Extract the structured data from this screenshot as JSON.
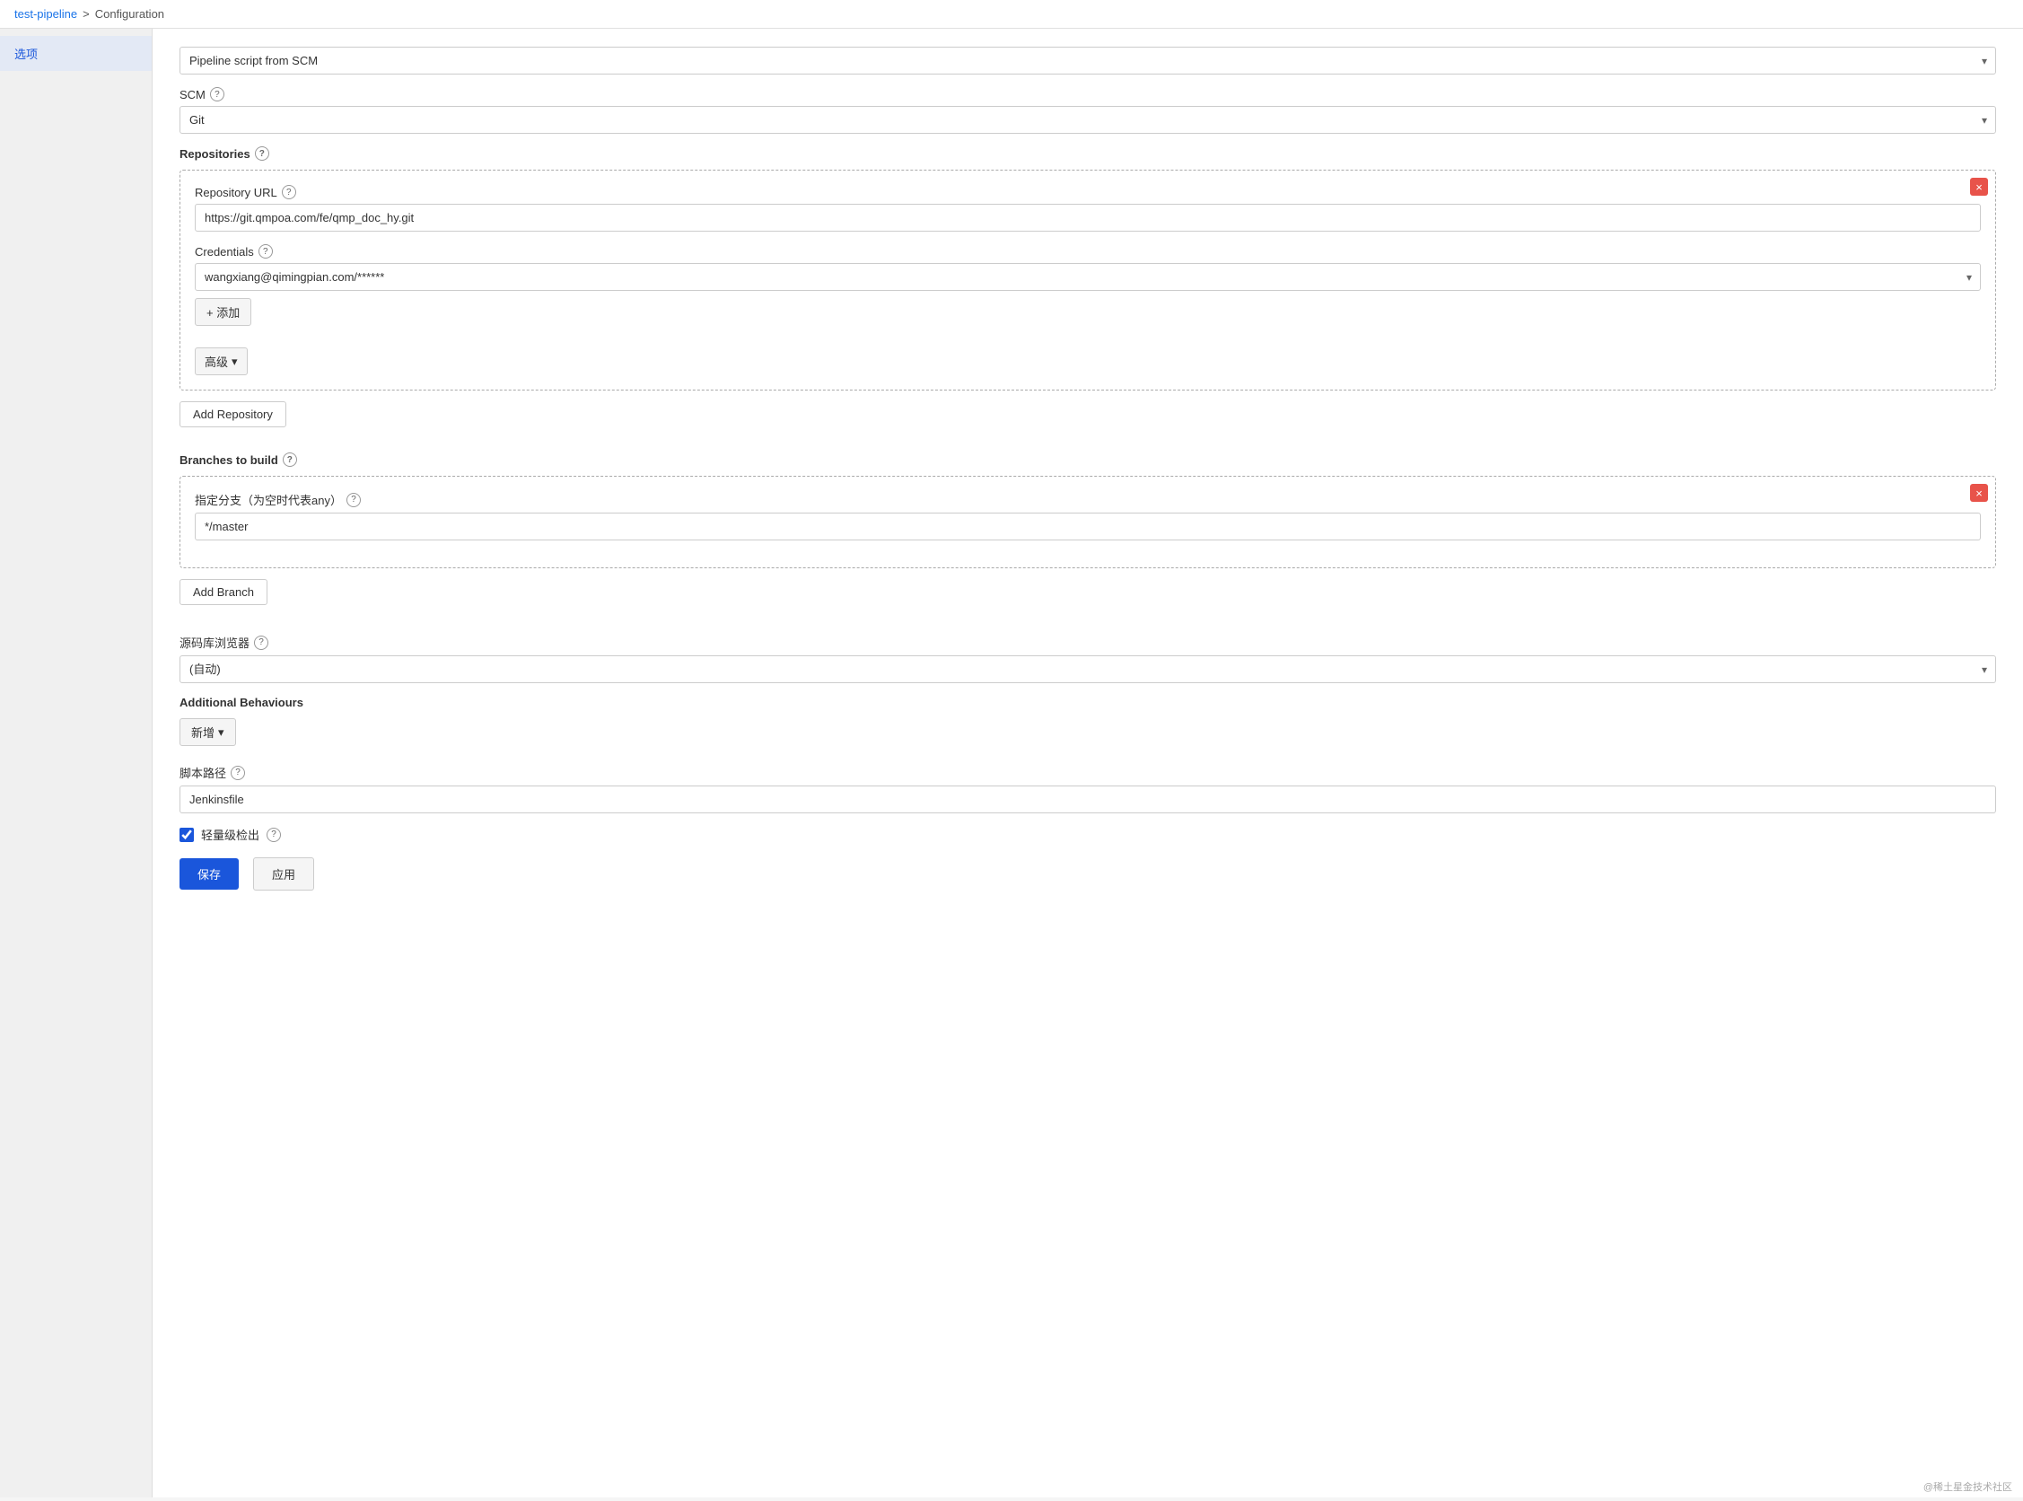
{
  "breadcrumb": {
    "project": "test-pipeline",
    "separator": ">",
    "page": "Configuration"
  },
  "sidebar": {
    "items": [
      {
        "label": "选项",
        "active": true
      }
    ]
  },
  "pipeline": {
    "script_source_label": "Pipeline script from SCM",
    "scm_label": "SCM",
    "scm_value": "Git",
    "repositories_label": "Repositories",
    "repository_url_label": "Repository URL",
    "repository_url_value": "https://git.qmpoa.com/fe/qmp_doc_hy.git",
    "credentials_label": "Credentials",
    "credentials_value": "wangxiang@qimingpian.com/******",
    "add_credential_btn": "+ 添加",
    "advanced_btn": "高级",
    "add_repository_btn": "Add Repository",
    "branches_label": "Branches to build",
    "branch_specifier_label": "指定分支（为空时代表any）",
    "branch_value": "*/master",
    "add_branch_btn": "Add Branch",
    "source_browser_label": "源码库浏览器",
    "source_browser_value": "(自动)",
    "additional_behaviours_label": "Additional Behaviours",
    "new_btn": "新增",
    "script_path_label": "脚本路径",
    "script_path_value": "Jenkinsfile",
    "lightweight_label": "轻量级检出",
    "save_btn": "保存",
    "apply_btn": "应用"
  },
  "icons": {
    "help": "?",
    "close": "×",
    "chevron_down": "▾",
    "chevron_right": "›",
    "plus": "+"
  },
  "watermark": "@稀土星金技术社区"
}
